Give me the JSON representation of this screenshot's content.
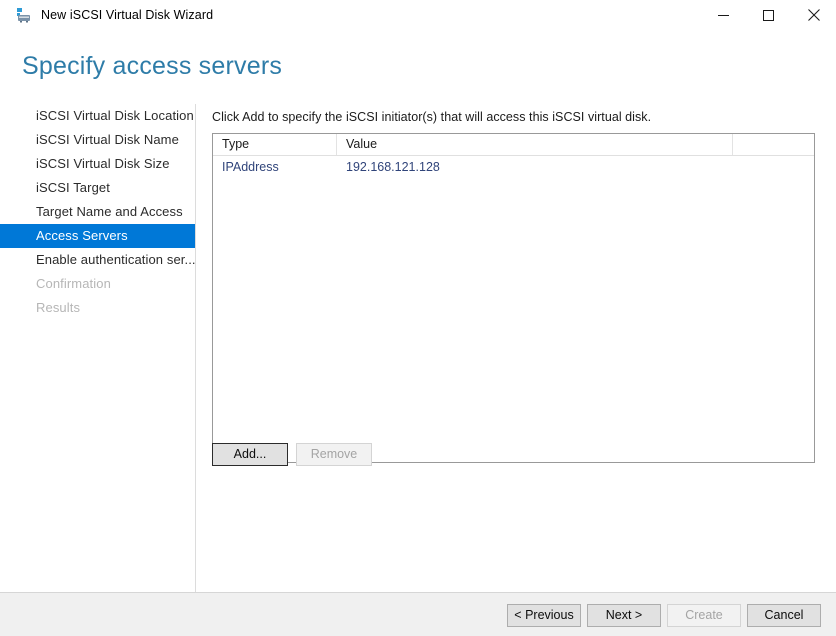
{
  "window": {
    "title": "New iSCSI Virtual Disk Wizard",
    "icon": "iscsi-disk-icon",
    "controls": {
      "minimize": "minimize-icon",
      "maximize": "maximize-icon",
      "close": "close-icon"
    }
  },
  "page": {
    "heading": "Specify access servers",
    "heading_color": "#2E7CA8"
  },
  "sidebar": {
    "selected_color": "#0078D7",
    "items": [
      {
        "label": "iSCSI Virtual Disk Location",
        "state": "normal"
      },
      {
        "label": "iSCSI Virtual Disk Name",
        "state": "normal"
      },
      {
        "label": "iSCSI Virtual Disk Size",
        "state": "normal"
      },
      {
        "label": "iSCSI Target",
        "state": "normal"
      },
      {
        "label": "Target Name and Access",
        "state": "normal"
      },
      {
        "label": "Access Servers",
        "state": "selected"
      },
      {
        "label": "Enable authentication ser...",
        "state": "normal"
      },
      {
        "label": "Confirmation",
        "state": "disabled"
      },
      {
        "label": "Results",
        "state": "disabled"
      }
    ]
  },
  "main": {
    "instruction": "Click Add to specify the iSCSI initiator(s) that will access this iSCSI virtual disk.",
    "table": {
      "columns": [
        "Type",
        "Value"
      ],
      "rows": [
        {
          "type": "IPAddress",
          "value": "192.168.121.128"
        }
      ]
    },
    "list_buttons": {
      "add": "Add...",
      "remove": "Remove"
    }
  },
  "footer": {
    "previous": "< Previous",
    "next": "Next >",
    "create": "Create",
    "cancel": "Cancel"
  }
}
